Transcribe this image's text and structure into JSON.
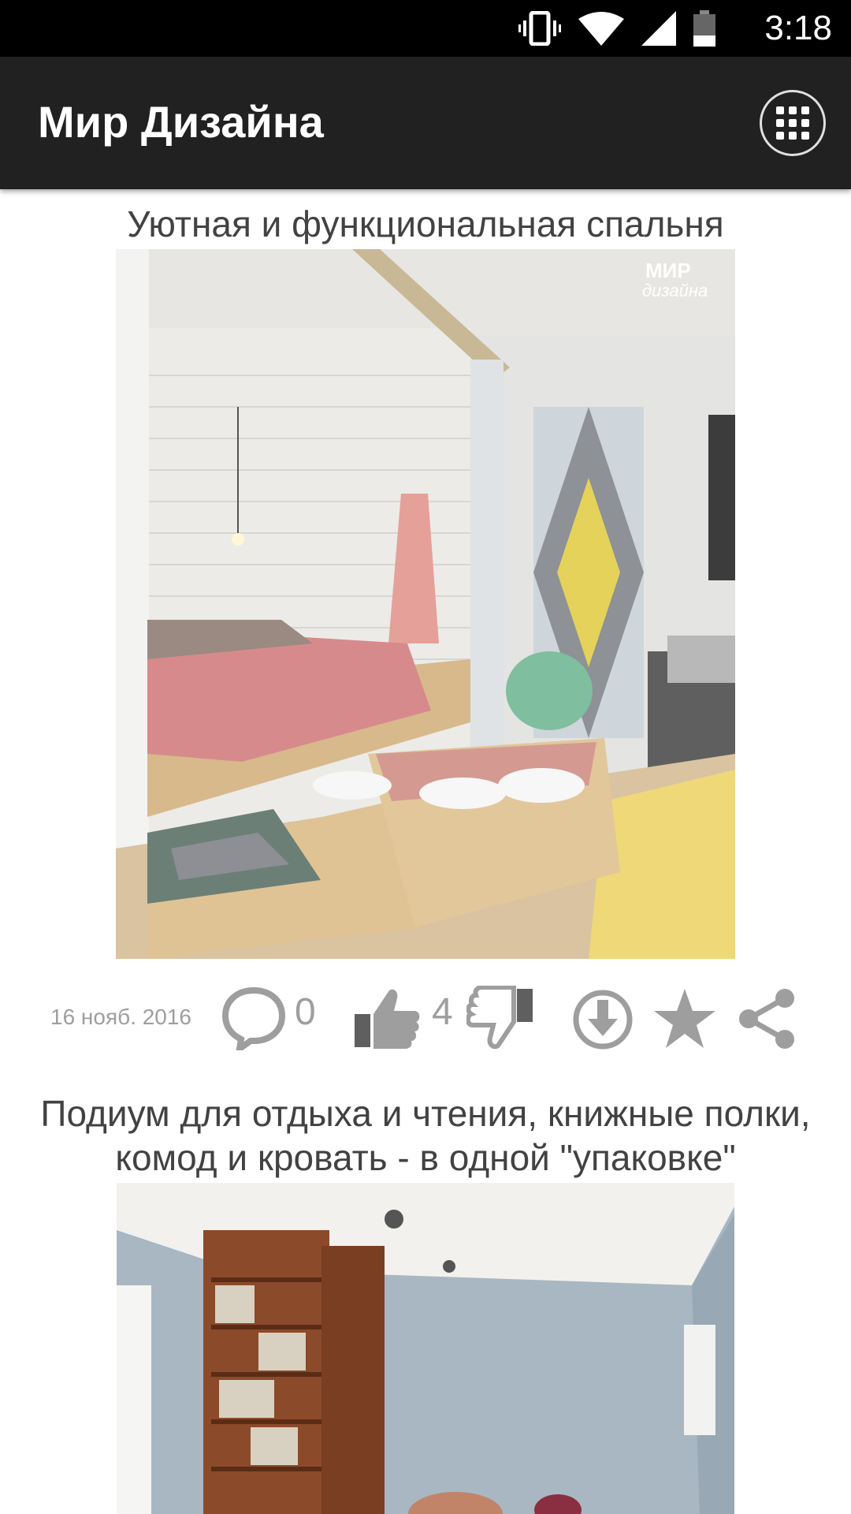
{
  "status_bar": {
    "time": "3:18",
    "icons": [
      "vibrate-icon",
      "wifi-icon",
      "signal-icon",
      "battery-icon"
    ]
  },
  "app_bar": {
    "title": "Мир Дизайна",
    "menu_icon": "grid-menu-icon"
  },
  "posts": [
    {
      "title": "Уютная и функциональная спальня",
      "image_desc": "bedroom-photo",
      "watermark": "МИР дизайна",
      "date": "16 нояб. 2016",
      "comments": "0",
      "likes": "4",
      "actions": [
        "comment-icon",
        "thumbs-up-icon",
        "thumbs-down-icon",
        "download-icon",
        "star-icon",
        "share-icon"
      ]
    },
    {
      "title_line1": "Подиум для отдыха и чтения, книжные полки,",
      "title_line2": "комод и кровать - в одной \"упаковке\"",
      "image_desc": "bookshelf-room-photo"
    }
  ],
  "colors": {
    "app_bar": "#212121",
    "status_bar": "#000000",
    "title_text": "#424242",
    "meta_text": "#9e9e9e"
  }
}
